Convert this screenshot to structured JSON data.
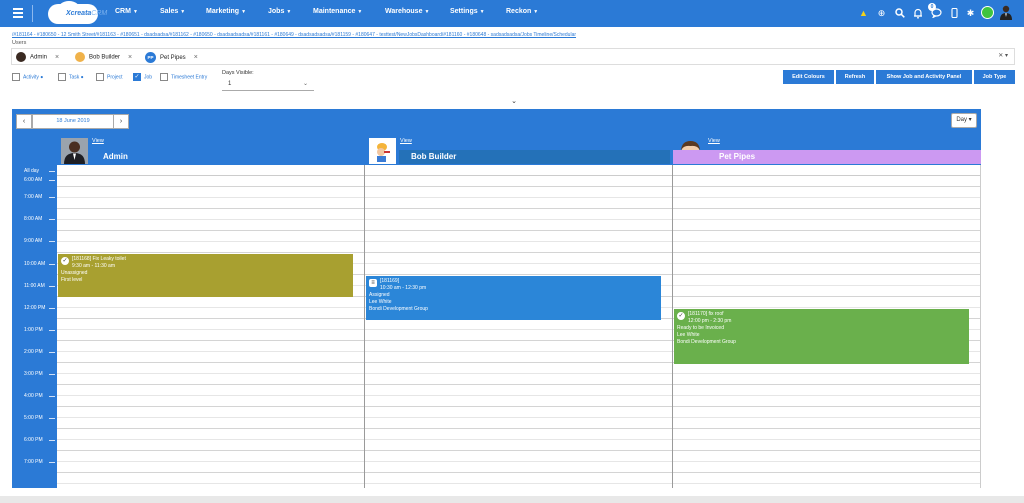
{
  "nav": {
    "logo_text": "Xcreata",
    "logo_sub": "CRM",
    "menus": [
      {
        "label": "CRM"
      },
      {
        "label": "Sales"
      },
      {
        "label": "Marketing"
      },
      {
        "label": "Jobs"
      },
      {
        "label": "Maintenance"
      },
      {
        "label": "Warehouse"
      },
      {
        "label": "Settings"
      },
      {
        "label": "Reckon"
      }
    ],
    "notification_count": "0"
  },
  "breadcrumb": "/#181164 - #180650 - 12 Smith Street/#181163 - #180651 - dsadsadsa/#181162 - #180650 - dsadsadsadsa/#181161 - #180649 - dsadsadsadsa/#181159 - #180647 - testtest/NewJobsDashboard/#181160 - #180648 - sadsadsadsa/Jobs Timeline/Schedular",
  "users_label": "Users",
  "user_chips": [
    {
      "label": "Admin",
      "initials": ""
    },
    {
      "label": "Bob Builder",
      "initials": ""
    },
    {
      "label": "Pet Pipes",
      "initials": "PP"
    }
  ],
  "filters": [
    {
      "label": "Activity",
      "checked": false
    },
    {
      "label": "Task",
      "checked": false
    },
    {
      "label": "Project",
      "checked": false
    },
    {
      "label": "Job",
      "checked": true
    },
    {
      "label": "Timesheet Entry",
      "checked": false
    }
  ],
  "days_visible": {
    "label": "Days Visible:",
    "value": "1"
  },
  "buttons": {
    "edit_colours": "Edit Colours",
    "refresh": "Refresh",
    "show_panel": "Show Job and Activity Panel",
    "job_type": "Job Type"
  },
  "calendar": {
    "date": "18 June 2019",
    "view_mode": "Day",
    "all_day_label": "All day",
    "times": [
      "6:00 AM",
      "7:00 AM",
      "8:00 AM",
      "9:00 AM",
      "10:00 AM",
      "11:00 AM",
      "12:00 PM",
      "1:00 PM",
      "2:00 PM",
      "3:00 PM",
      "4:00 PM",
      "5:00 PM",
      "6:00 PM",
      "7:00 PM"
    ],
    "resources": [
      {
        "view": "View",
        "name": "Admin",
        "color": "#2b7ad6"
      },
      {
        "view": "View",
        "name": "Bob Builder",
        "color": "#2471b8"
      },
      {
        "view": "View",
        "name": "Pet Pipes",
        "color": "#cc99f2"
      }
    ],
    "events": [
      {
        "title": "[181168] Fix Leaky toilet",
        "time": "9:30 am - 11:30 am",
        "status": "Unassigned",
        "contact": "First level",
        "company": "",
        "color": "#a8a030"
      },
      {
        "title": "[181169]",
        "time": "10:30 am - 12:30 pm",
        "status": "Assigned",
        "contact": "Lee White",
        "company": "Bondi Development Group",
        "color": "#2b86d8"
      },
      {
        "title": "[181170] fix roof",
        "time": "12:00 pm - 2:30 pm",
        "status": "Ready to be Invoiced",
        "contact": "Lee White",
        "company": "Bondi Development Group",
        "color": "#6ab04c"
      }
    ]
  }
}
